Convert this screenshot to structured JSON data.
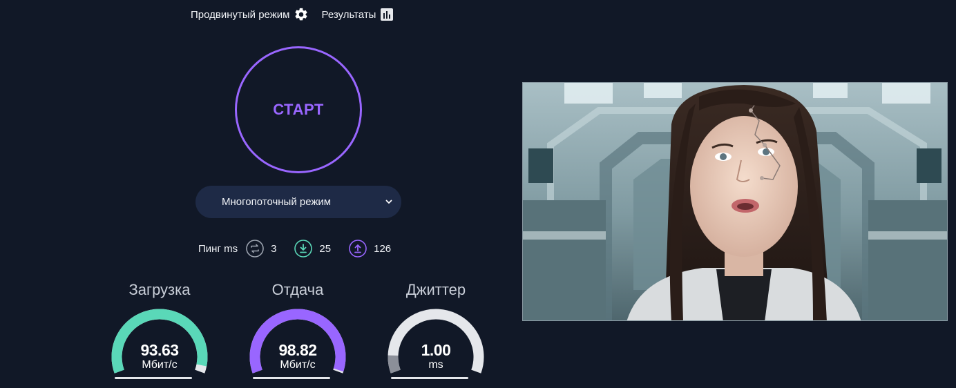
{
  "nav": {
    "advanced_label": "Продвинутый режим",
    "results_label": "Результаты"
  },
  "start": {
    "label": "СТАРТ"
  },
  "mode_select": {
    "selected": "Многопоточный режим"
  },
  "ping": {
    "label": "Пинг ms",
    "idle": "3",
    "download": "25",
    "upload": "126"
  },
  "gauges": [
    {
      "title": "Загрузка",
      "value": "93.63",
      "unit": "Мбит/с",
      "fill": 0.96,
      "color": "#5ad8b8"
    },
    {
      "title": "Отдача",
      "value": "98.82",
      "unit": "Мбит/с",
      "fill": 0.99,
      "color": "#9966ff"
    },
    {
      "title": "Джиттер",
      "value": "1.00",
      "unit": "ms",
      "fill": 0.1,
      "color": "#8b8f99"
    }
  ],
  "colors": {
    "background": "#111827",
    "accent": "#9966ff",
    "download": "#5ad8b8",
    "select_bg": "#1e2a46"
  },
  "icons": {
    "advanced": "gear-icon",
    "results": "bar-chart-icon",
    "ping_idle": "repeat-icon",
    "ping_download": "download-icon",
    "ping_upload": "upload-icon",
    "select": "chevron-down-icon"
  }
}
